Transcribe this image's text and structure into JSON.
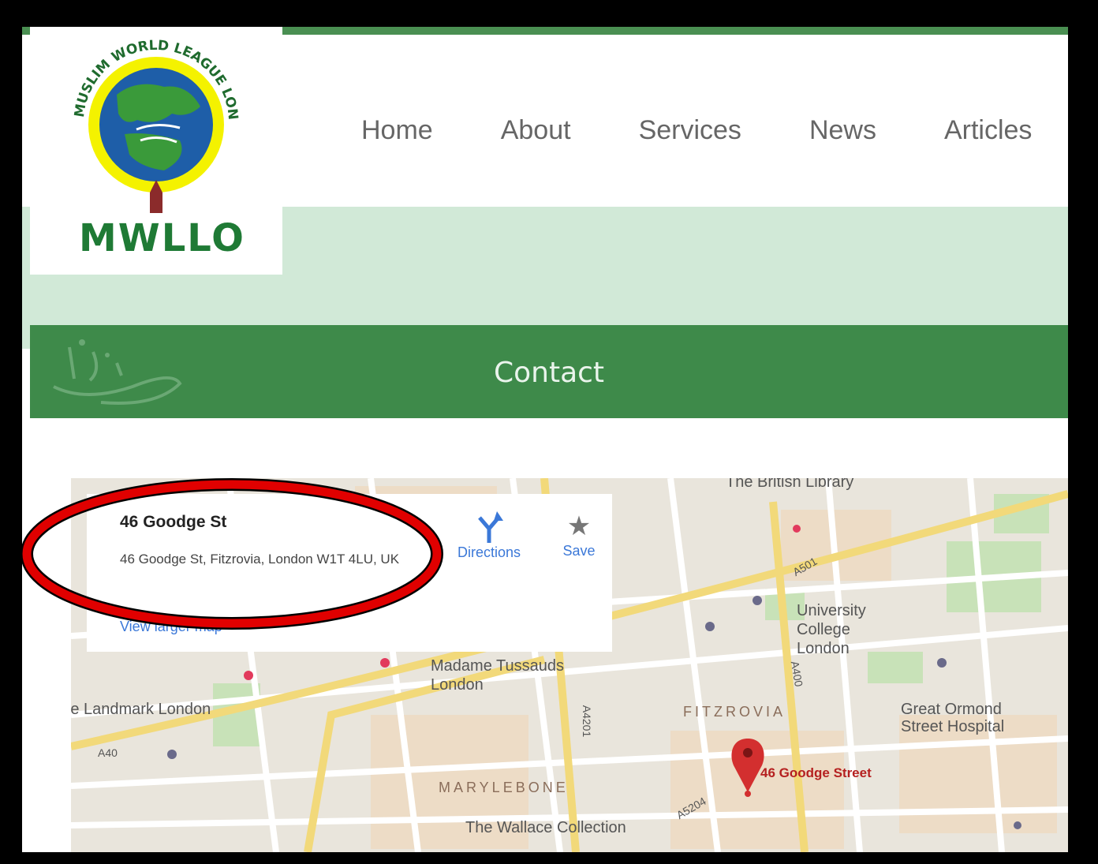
{
  "logo": {
    "text": "MWLLO",
    "ring_text": "MUSLIM WORLD LEAGUE LONDON OFFICE"
  },
  "nav": {
    "items": [
      "Home",
      "About",
      "Services",
      "News",
      "Articles"
    ]
  },
  "contact_bar": {
    "title": "Contact"
  },
  "map": {
    "info_card": {
      "place_name": "46 Goodge St",
      "address": "46 Goodge St, Fitzrovia, London W1T 4LU, UK",
      "larger_map_link": "View larger map",
      "directions_label": "Directions",
      "save_label": "Save"
    },
    "labels": {
      "british_library": "The British Library",
      "university": "University College London",
      "madame_tussauds": "Madame Tussauds London",
      "landmark": "The Landmark London",
      "fitzrovia": "FITZROVIA",
      "great_ormond": "Great Ormond Street Hospital",
      "marylebone": "MARYLEBONE",
      "wallace": "The Wallace Collection",
      "pin_label": "46 Goodge Street",
      "road_a501": "A501",
      "road_a40": "A40",
      "road_a4201": "A4201",
      "road_a400": "A400",
      "road_a5204": "A5204"
    }
  },
  "colors": {
    "brand_green": "#3e8a4a",
    "hero_green": "#d1e9d7",
    "link_blue": "#3b78d8",
    "annotation_red": "#e00000",
    "pin_red": "#d32f2f"
  }
}
